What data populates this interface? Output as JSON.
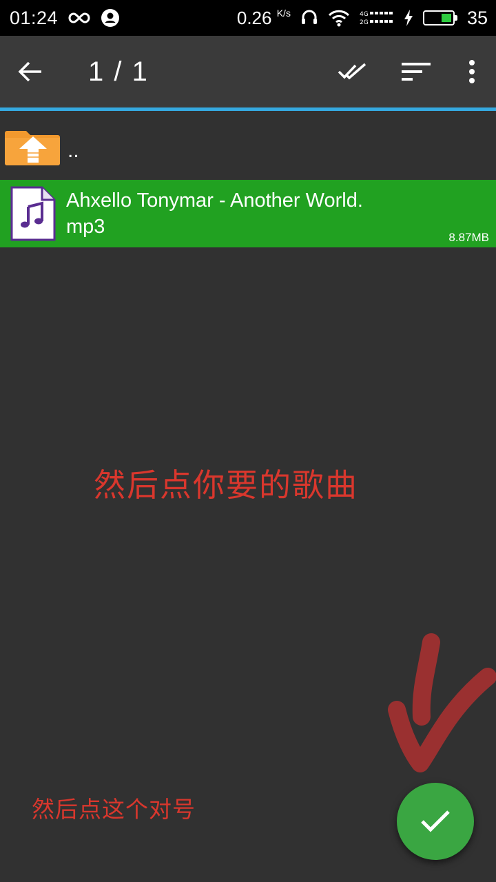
{
  "status_bar": {
    "time": "01:24",
    "net_speed": "0.26",
    "net_speed_unit": "K/s",
    "battery_level": "35",
    "icons": [
      "infinity-icon",
      "account-circle-icon",
      "headset-icon",
      "wifi-icon",
      "signal-4g-2g-icon",
      "charging-icon",
      "battery-icon"
    ]
  },
  "toolbar": {
    "title": "1 / 1",
    "icons": [
      "back-arrow-icon",
      "select-all-icon",
      "sort-icon",
      "more-vert-icon"
    ]
  },
  "file_list": {
    "parent": {
      "label": "..",
      "icon": "folder-up-icon"
    },
    "items": [
      {
        "name": "Ahxello Tonymar - Another World.\nmp3",
        "size": "8.87MB",
        "icon": "audio-file-icon",
        "selected": true
      }
    ]
  },
  "annotations": {
    "song_hint": "然后点你要的歌曲",
    "check_hint": "然后点这个对号"
  },
  "fab": {
    "icon": "check-icon"
  },
  "colors": {
    "background": "#313131",
    "toolbar": "#3a3a3a",
    "accent_line": "#35a9e0",
    "selected_row": "#21a121",
    "fab": "#3aa642",
    "annotation": "#d9372d"
  }
}
